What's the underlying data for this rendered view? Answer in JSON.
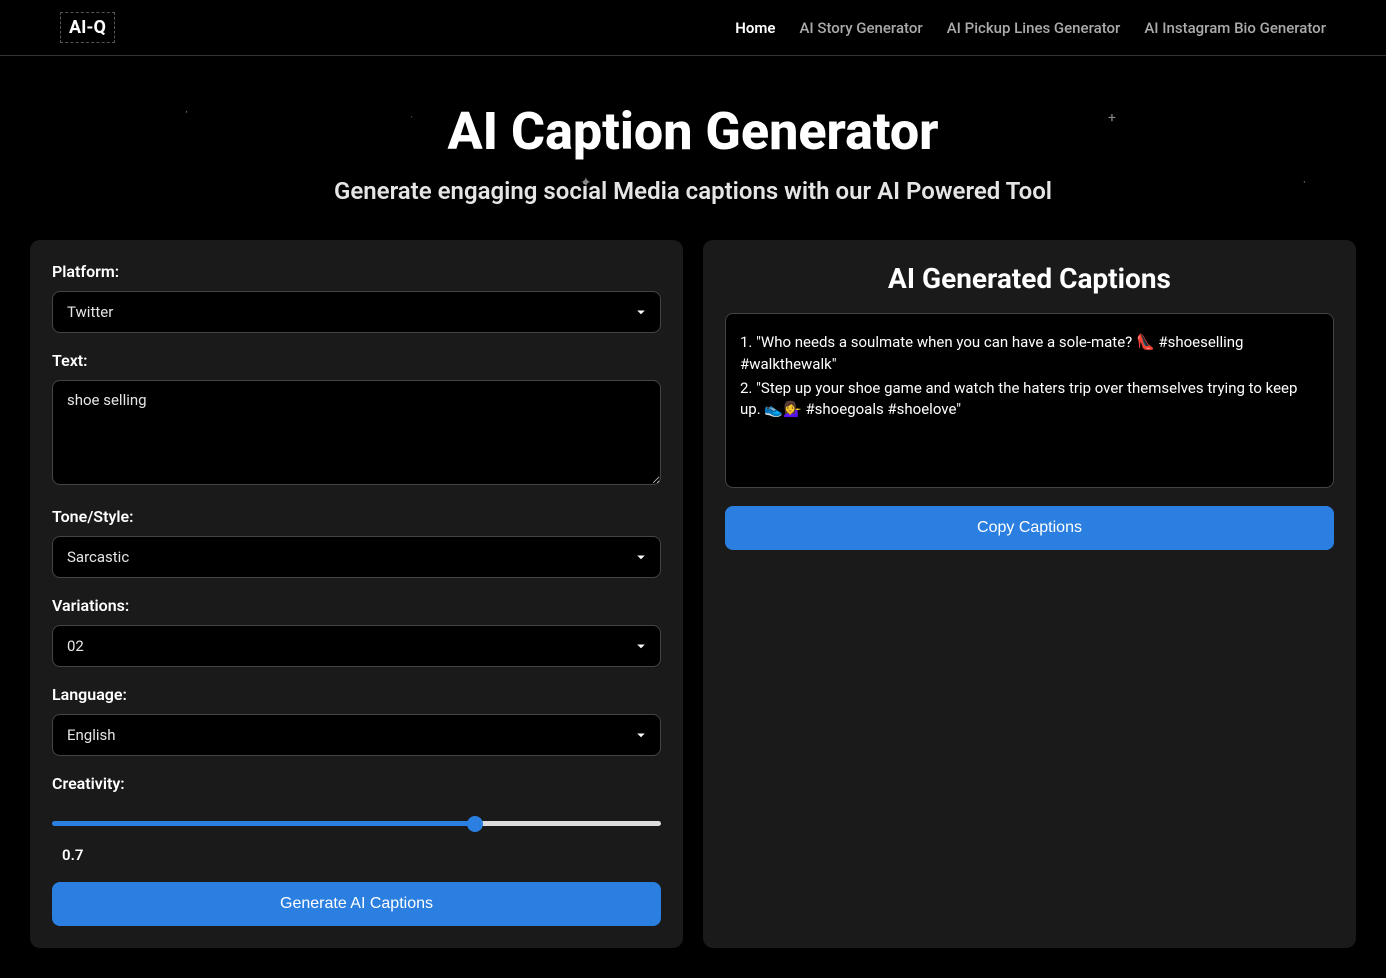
{
  "header": {
    "logo": "AI-Q",
    "nav": [
      {
        "label": "Home",
        "active": true
      },
      {
        "label": "AI Story Generator",
        "active": false
      },
      {
        "label": "AI Pickup Lines Generator",
        "active": false
      },
      {
        "label": "AI Instagram Bio Generator",
        "active": false
      }
    ]
  },
  "hero": {
    "title": "AI Caption Generator",
    "subtitle": "Generate engaging social Media captions with our AI Powered Tool"
  },
  "form": {
    "platform": {
      "label": "Platform:",
      "value": "Twitter"
    },
    "text": {
      "label": "Text:",
      "value": "shoe selling"
    },
    "tone": {
      "label": "Tone/Style:",
      "value": "Sarcastic"
    },
    "variations": {
      "label": "Variations:",
      "value": "02"
    },
    "language": {
      "label": "Language:",
      "value": "English"
    },
    "creativity": {
      "label": "Creativity:",
      "value": 0.7,
      "display": "0.7",
      "min": 0,
      "max": 1
    },
    "generate_button": "Generate AI Captions"
  },
  "results": {
    "title": "AI Generated Captions",
    "captions": [
      "1. \"Who needs a soulmate when you can have a sole-mate? 👠 #shoeselling #walkthewalk\"",
      "2. \"Step up your shoe game and watch the haters trip over themselves trying to keep up. 👟💁‍♀️ #shoegoals #shoelove\""
    ],
    "copy_button": "Copy Captions"
  }
}
